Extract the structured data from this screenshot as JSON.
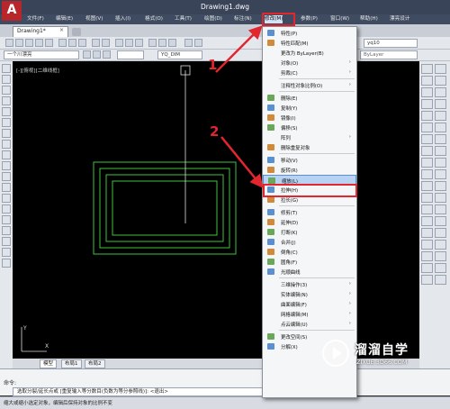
{
  "app": {
    "logo": "A",
    "title": "Drawing1.dwg"
  },
  "menubar": [
    "文件(F)",
    "编辑(E)",
    "视图(V)",
    "插入(I)",
    "格式(O)",
    "工具(T)",
    "绘图(D)",
    "标注(N)",
    "修改(M)",
    "参数(P)",
    "窗口(W)",
    "帮助(H)",
    "漂亮设计"
  ],
  "tabs": {
    "active": "Drawing1*",
    "close": "×"
  },
  "toolbar": {
    "layer": "一个川漂亮",
    "dimstyle": "YQ_DIM",
    "bylayer": "ByLayer",
    "user": "yq10"
  },
  "canvas": {
    "view_label": "[-][俯视][二维线框]"
  },
  "layout_tabs": [
    "模型",
    "布局1",
    "布局2"
  ],
  "command": {
    "label": "命令:",
    "line": "选取分裂/延长点或 [重复输入等分数目(负数为等分参照线)]: <退出>",
    "status": "缩大或缩小选定对象，编辑后保持对象的比例不变"
  },
  "dropdown": [
    {
      "label": "特性(P)",
      "icon": "properties-icon"
    },
    {
      "label": "特性匹配(M)",
      "icon": "match-properties-icon"
    },
    {
      "label": "更改为 ByLayer(B)",
      "icon": ""
    },
    {
      "label": "对象(O)",
      "icon": "",
      "arrow": true
    },
    {
      "label": "剪裁(C)",
      "icon": "",
      "arrow": true
    },
    {
      "sep": true
    },
    {
      "label": "注释性对象比例(O)",
      "icon": "",
      "arrow": true
    },
    {
      "sep": true
    },
    {
      "label": "删除(E)",
      "icon": "erase-icon"
    },
    {
      "label": "复制(Y)",
      "icon": "copy-icon"
    },
    {
      "label": "镜像(I)",
      "icon": "mirror-icon"
    },
    {
      "label": "偏移(S)",
      "icon": "offset-icon"
    },
    {
      "label": "阵列",
      "icon": "",
      "arrow": true
    },
    {
      "label": "删除重复对象",
      "icon": "delete-duplicates-icon"
    },
    {
      "sep": true
    },
    {
      "label": "移动(V)",
      "icon": "move-icon"
    },
    {
      "label": "旋转(R)",
      "icon": "rotate-icon"
    },
    {
      "label": "缩放(L)",
      "icon": "scale-icon",
      "highlight": true
    },
    {
      "label": "拉伸(H)",
      "icon": "stretch-icon"
    },
    {
      "label": "拉长(G)",
      "icon": "lengthen-icon"
    },
    {
      "sep": true
    },
    {
      "label": "修剪(T)",
      "icon": "trim-icon"
    },
    {
      "label": "延伸(D)",
      "icon": "extend-icon"
    },
    {
      "label": "打断(K)",
      "icon": "break-icon"
    },
    {
      "label": "合并(J)",
      "icon": "join-icon"
    },
    {
      "label": "倒角(C)",
      "icon": "chamfer-icon"
    },
    {
      "label": "圆角(F)",
      "icon": "fillet-icon"
    },
    {
      "label": "光顺曲线",
      "icon": "blend-curves-icon"
    },
    {
      "sep": true
    },
    {
      "label": "三维操作(3)",
      "icon": "",
      "arrow": true
    },
    {
      "label": "实体编辑(N)",
      "icon": "",
      "arrow": true
    },
    {
      "label": "曲面编辑(F)",
      "icon": "",
      "arrow": true
    },
    {
      "label": "网格编辑(M)",
      "icon": "",
      "arrow": true
    },
    {
      "label": "点云编辑(U)",
      "icon": "",
      "arrow": true
    },
    {
      "sep": true
    },
    {
      "label": "更改空间(S)",
      "icon": "change-space-icon"
    },
    {
      "label": "分解(X)",
      "icon": "explode-icon"
    }
  ],
  "callouts": [
    "1",
    "2"
  ],
  "watermark": {
    "title": "溜溜自学",
    "sub": "ZIXUE.3D66.COM"
  },
  "colors": {
    "highlight": "#b8d3f1",
    "annotation": "#e1262f",
    "rect_lines": "#3fbf3f"
  }
}
